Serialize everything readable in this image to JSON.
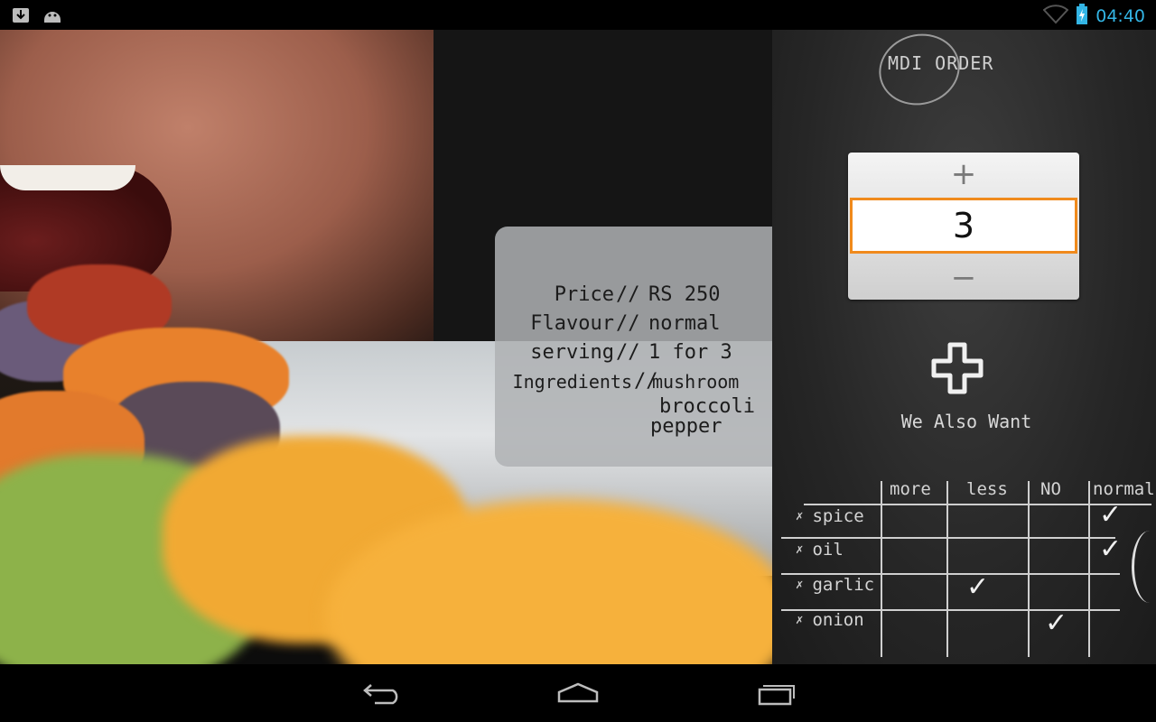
{
  "status_bar": {
    "time": "04:40",
    "left_icons": [
      "download-icon",
      "android-icon"
    ],
    "right_icons": [
      "wifi-icon",
      "battery-charging-icon"
    ],
    "accent_color": "#33b5e5"
  },
  "info_card": {
    "rows": [
      {
        "label": "Price",
        "sep": "//",
        "value": "RS 250"
      },
      {
        "label": "Flavour",
        "sep": "//",
        "value": "normal"
      },
      {
        "label": "serving",
        "sep": "//",
        "value": "1 for 3"
      },
      {
        "label": "Ingredients",
        "sep": "//",
        "value": "mushroom"
      }
    ],
    "ingredients_extra": [
      "broccoli",
      "pepper"
    ]
  },
  "chalkboard": {
    "order_tag": "MDI  ORDER",
    "quantity": {
      "plus": "+",
      "value": "3",
      "minus": "−",
      "highlight_color": "#f08a1c"
    },
    "also_want_label": "We Also Want",
    "table": {
      "columns": [
        "more",
        "less",
        "NO",
        "normal"
      ],
      "rows": [
        {
          "name": "spice",
          "checked": "normal"
        },
        {
          "name": "oil",
          "checked": "normal"
        },
        {
          "name": "garlic",
          "checked": "less"
        },
        {
          "name": "onion",
          "checked": "NO"
        }
      ],
      "row_mark": "✗"
    }
  },
  "nav_bar": {
    "buttons": [
      "back-icon",
      "home-icon",
      "recents-icon"
    ]
  }
}
